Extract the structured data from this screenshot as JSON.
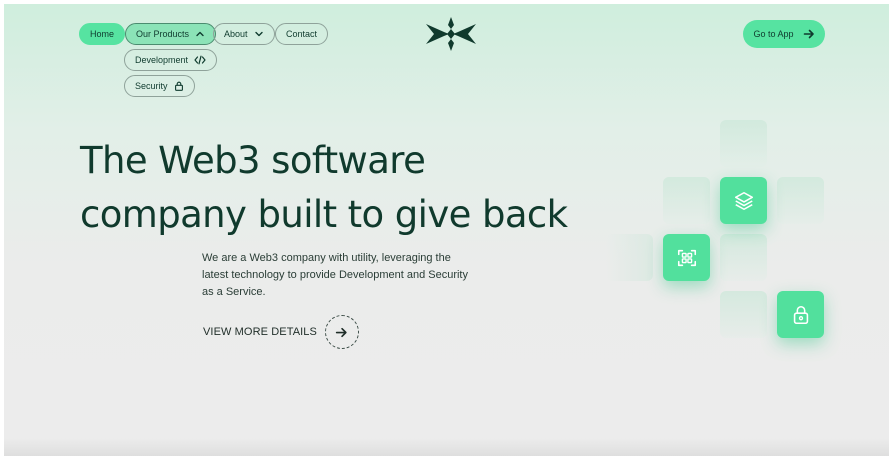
{
  "nav": {
    "home": "Home",
    "products": "Our Products",
    "about": "About",
    "contact": "Contact",
    "dropdown": {
      "development": "Development",
      "security": "Security"
    },
    "go_app": "Go to App"
  },
  "hero": {
    "line1": "The Web3 software",
    "line2": "company built to give back",
    "lede": "We are a Web3 company with utility, leveraging the latest technology to provide Development and Security as a Service.",
    "cta": "VIEW MORE DETAILS"
  },
  "colors": {
    "accent": "#56e3a1",
    "brand_dark": "#103a2d"
  },
  "icons": {
    "tile_1": "layers-icon",
    "tile_2": "scan-icon",
    "tile_3": "lock-icon"
  }
}
